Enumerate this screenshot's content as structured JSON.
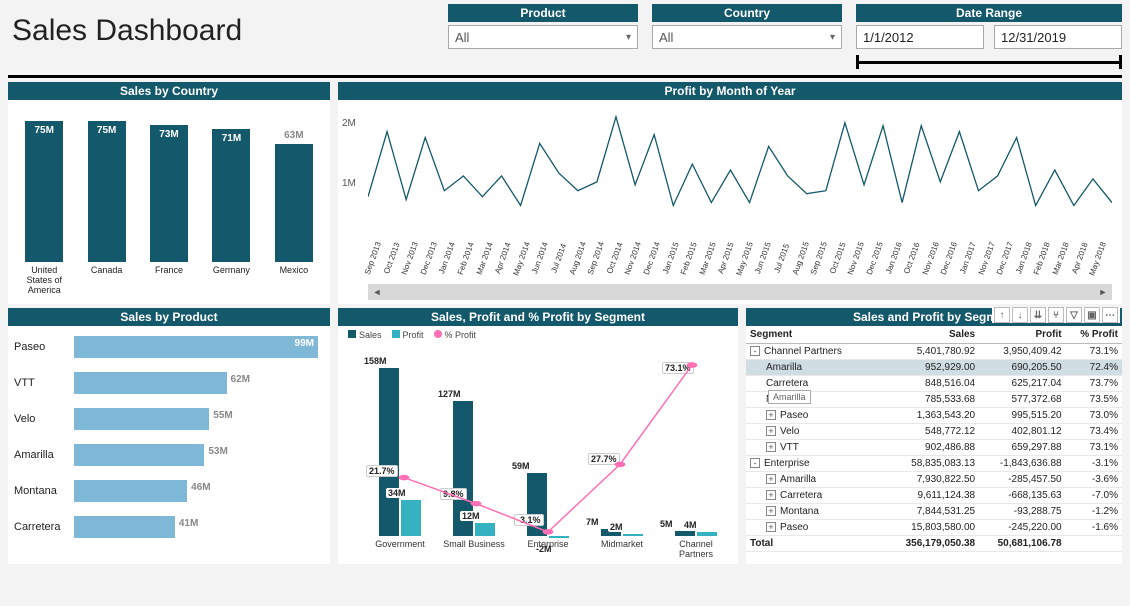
{
  "title": "Sales Dashboard",
  "filters": {
    "product": {
      "label": "Product",
      "value": "All"
    },
    "country": {
      "label": "Country",
      "value": "All"
    },
    "date": {
      "label": "Date Range",
      "from": "1/1/2012",
      "to": "12/31/2019"
    }
  },
  "sales_by_country": {
    "title": "Sales by Country",
    "categories": [
      "United States of America",
      "Canada",
      "France",
      "Germany",
      "Mexico"
    ],
    "labels": [
      "75M",
      "75M",
      "73M",
      "71M",
      "63M"
    ],
    "values": [
      75,
      75,
      73,
      71,
      63
    ]
  },
  "profit_by_month": {
    "title": "Profit by Month of Year",
    "yticks": [
      "2M",
      "1M"
    ],
    "months": [
      "Sep 2013",
      "Oct 2013",
      "Nov 2013",
      "Dec 2013",
      "Jan 2014",
      "Feb 2014",
      "Mar 2014",
      "Apr 2014",
      "May 2014",
      "Jun 2014",
      "Jul 2014",
      "Aug 2014",
      "Sep 2014",
      "Oct 2014",
      "Nov 2014",
      "Dec 2014",
      "Jan 2015",
      "Feb 2015",
      "Mar 2015",
      "Apr 2015",
      "May 2015",
      "Jun 2015",
      "Jul 2015",
      "Aug 2015",
      "Sep 2015",
      "Oct 2015",
      "Nov 2015",
      "Dec 2015",
      "Jan 2016",
      "Oct 2016",
      "Nov 2016",
      "Dec 2016",
      "Jan 2017",
      "Nov 2017",
      "Dec 2017",
      "Jan 2018",
      "Feb 2018",
      "Mar 2018",
      "Apr 2018",
      "May 2018"
    ],
    "values": [
      0.7,
      1.8,
      0.65,
      1.7,
      0.8,
      1.05,
      0.7,
      1.05,
      0.55,
      1.6,
      1.1,
      0.8,
      0.95,
      2.05,
      0.9,
      1.75,
      0.55,
      1.25,
      0.6,
      1.15,
      0.6,
      1.55,
      1.05,
      0.75,
      0.8,
      1.95,
      0.9,
      1.9,
      0.6,
      1.9,
      0.95,
      1.8,
      0.8,
      1.05,
      1.7,
      0.55,
      1.15,
      0.55,
      1.0,
      0.6
    ]
  },
  "sales_by_product": {
    "title": "Sales by Product",
    "rows": [
      {
        "name": "Paseo",
        "value": 99,
        "label": "99M"
      },
      {
        "name": "VTT",
        "value": 62,
        "label": "62M"
      },
      {
        "name": "Velo",
        "value": 55,
        "label": "55M"
      },
      {
        "name": "Amarilla",
        "value": 53,
        "label": "53M"
      },
      {
        "name": "Montana",
        "value": 46,
        "label": "46M"
      },
      {
        "name": "Carretera",
        "value": 41,
        "label": "41M"
      }
    ]
  },
  "by_segment": {
    "title": "Sales, Profit and % Profit by Segment",
    "legend": {
      "sales": "Sales",
      "profit": "Profit",
      "pct": "% Profit"
    },
    "segments": [
      {
        "name": "Government",
        "sales": 158,
        "sales_label": "158M",
        "profit": 34,
        "profit_label": "34M",
        "pct": 21.7,
        "pct_label": "21.7%"
      },
      {
        "name": "Small Business",
        "sales": 127,
        "sales_label": "127M",
        "profit": 12,
        "profit_label": "12M",
        "pct": 9.8,
        "pct_label": "9.8%"
      },
      {
        "name": "Enterprise",
        "sales": 59,
        "sales_label": "59M",
        "profit": -2,
        "profit_label": "-2M",
        "pct": -3.1,
        "pct_label": "-3.1%"
      },
      {
        "name": "Midmarket",
        "sales": 7,
        "sales_label": "7M",
        "profit": 2,
        "profit_label": "2M",
        "pct": 27.7,
        "pct_label": "27.7%"
      },
      {
        "name": "Channel Partners",
        "sales": 5,
        "sales_label": "5M",
        "profit": 4,
        "profit_label": "4M",
        "pct": 73.1,
        "pct_label": "73.1%"
      }
    ]
  },
  "table": {
    "title": "Sales and Profit by Segment",
    "columns": [
      "Segment",
      "Sales",
      "Profit",
      "% Profit"
    ],
    "tooltip": "Amarilla",
    "rows": [
      {
        "level": 0,
        "exp": "-",
        "cells": [
          "Channel Partners",
          "5,401,780.92",
          "3,950,409.42",
          "73.1%"
        ]
      },
      {
        "level": 1,
        "exp": "",
        "sel": true,
        "cells": [
          "Amarilla",
          "952,929.00",
          "690,205.50",
          "72.4%"
        ]
      },
      {
        "level": 1,
        "exp": "",
        "cells": [
          "Carretera",
          "848,516.04",
          "625,217.04",
          "73.7%"
        ]
      },
      {
        "level": 1,
        "exp": "",
        "cells": [
          "Montana",
          "785,533.68",
          "577,372.68",
          "73.5%"
        ]
      },
      {
        "level": 1,
        "exp": "+",
        "cells": [
          "Paseo",
          "1,363,543.20",
          "995,515.20",
          "73.0%"
        ]
      },
      {
        "level": 1,
        "exp": "+",
        "cells": [
          "Velo",
          "548,772.12",
          "402,801.12",
          "73.4%"
        ]
      },
      {
        "level": 1,
        "exp": "+",
        "cells": [
          "VTT",
          "902,486.88",
          "659,297.88",
          "73.1%"
        ]
      },
      {
        "level": 0,
        "exp": "-",
        "cells": [
          "Enterprise",
          "58,835,083.13",
          "-1,843,636.88",
          "-3.1%"
        ]
      },
      {
        "level": 1,
        "exp": "+",
        "cells": [
          "Amarilla",
          "7,930,822.50",
          "-285,457.50",
          "-3.6%"
        ]
      },
      {
        "level": 1,
        "exp": "+",
        "cells": [
          "Carretera",
          "9,611,124.38",
          "-668,135.63",
          "-7.0%"
        ]
      },
      {
        "level": 1,
        "exp": "+",
        "cells": [
          "Montana",
          "7,844,531.25",
          "-93,288.75",
          "-1.2%"
        ]
      },
      {
        "level": 1,
        "exp": "+",
        "cells": [
          "Paseo",
          "15,803,580.00",
          "-245,220.00",
          "-1.6%"
        ]
      },
      {
        "level": 0,
        "exp": "",
        "bold": true,
        "cells": [
          "Total",
          "356,179,050.38",
          "50,681,106.78",
          ""
        ]
      }
    ]
  },
  "chart_data": [
    {
      "id": "sales_by_country",
      "type": "bar",
      "title": "Sales by Country",
      "ylabel": "Sales",
      "categories": [
        "United States of America",
        "Canada",
        "France",
        "Germany",
        "Mexico"
      ],
      "values": [
        75000000,
        75000000,
        73000000,
        71000000,
        63000000
      ],
      "ylim": [
        0,
        80000000
      ]
    },
    {
      "id": "profit_by_month",
      "type": "line",
      "title": "Profit by Month of Year",
      "ylabel": "Profit",
      "yticks": [
        1000000,
        2000000
      ],
      "x": [
        "Sep 2013",
        "Oct 2013",
        "Nov 2013",
        "Dec 2013",
        "Jan 2014",
        "Feb 2014",
        "Mar 2014",
        "Apr 2014",
        "May 2014",
        "Jun 2014",
        "Jul 2014",
        "Aug 2014",
        "Sep 2014",
        "Oct 2014",
        "Nov 2014",
        "Dec 2014",
        "Jan 2015",
        "Feb 2015",
        "Mar 2015",
        "Apr 2015",
        "May 2015",
        "Jun 2015",
        "Jul 2015",
        "Aug 2015",
        "Sep 2015",
        "Oct 2015",
        "Nov 2015",
        "Dec 2015",
        "Jan 2016",
        "Oct 2016",
        "Nov 2016",
        "Dec 2016",
        "Jan 2017",
        "Nov 2017",
        "Dec 2017",
        "Jan 2018",
        "Feb 2018",
        "Mar 2018",
        "Apr 2018",
        "May 2018"
      ],
      "values": [
        700000,
        1800000,
        650000,
        1700000,
        800000,
        1050000,
        700000,
        1050000,
        550000,
        1600000,
        1100000,
        800000,
        950000,
        2050000,
        900000,
        1750000,
        550000,
        1250000,
        600000,
        1150000,
        600000,
        1550000,
        1050000,
        750000,
        800000,
        1950000,
        900000,
        1900000,
        600000,
        1900000,
        950000,
        1800000,
        800000,
        1050000,
        1700000,
        550000,
        1150000,
        550000,
        1000000,
        600000
      ],
      "ylim": [
        0,
        2200000
      ]
    },
    {
      "id": "sales_by_product",
      "type": "bar",
      "orientation": "horizontal",
      "title": "Sales by Product",
      "xlabel": "Sales",
      "categories": [
        "Paseo",
        "VTT",
        "Velo",
        "Amarilla",
        "Montana",
        "Carretera"
      ],
      "values": [
        99000000,
        62000000,
        55000000,
        53000000,
        46000000,
        41000000
      ],
      "xlim": [
        0,
        100000000
      ]
    },
    {
      "id": "sales_profit_pct_by_segment",
      "type": "bar",
      "secondary_type": "line",
      "title": "Sales, Profit and % Profit by Segment",
      "categories": [
        "Government",
        "Small Business",
        "Enterprise",
        "Midmarket",
        "Channel Partners"
      ],
      "series": [
        {
          "name": "Sales",
          "axis": "primary",
          "values": [
            158000000,
            127000000,
            59000000,
            7000000,
            5000000
          ]
        },
        {
          "name": "Profit",
          "axis": "primary",
          "values": [
            34000000,
            12000000,
            -2000000,
            2000000,
            4000000
          ]
        },
        {
          "name": "% Profit",
          "axis": "secondary",
          "type": "line",
          "values": [
            21.7,
            9.8,
            -3.1,
            27.7,
            73.1
          ]
        }
      ],
      "ylim": [
        -5000000,
        160000000
      ],
      "y2lim": [
        -10,
        80
      ]
    },
    {
      "id": "sales_and_profit_by_segment",
      "type": "table",
      "title": "Sales and Profit by Segment",
      "columns": [
        "Segment",
        "Sales",
        "Profit",
        "% Profit"
      ],
      "rows": [
        [
          "Channel Partners",
          5401780.92,
          3950409.42,
          73.1
        ],
        [
          "  Amarilla",
          952929.0,
          690205.5,
          72.4
        ],
        [
          "  Carretera",
          848516.04,
          625217.04,
          73.7
        ],
        [
          "  Montana",
          785533.68,
          577372.68,
          73.5
        ],
        [
          "  Paseo",
          1363543.2,
          995515.2,
          73.0
        ],
        [
          "  Velo",
          548772.12,
          402801.12,
          73.4
        ],
        [
          "  VTT",
          902486.88,
          659297.88,
          73.1
        ],
        [
          "Enterprise",
          58835083.13,
          -1843636.88,
          -3.1
        ],
        [
          "  Amarilla",
          7930822.5,
          -285457.5,
          -3.6
        ],
        [
          "  Carretera",
          9611124.38,
          -668135.63,
          -7.0
        ],
        [
          "  Montana",
          7844531.25,
          -93288.75,
          -1.2
        ],
        [
          "  Paseo",
          15803580.0,
          -245220.0,
          -1.6
        ],
        [
          "Total",
          356179050.38,
          50681106.78,
          null
        ]
      ]
    }
  ]
}
